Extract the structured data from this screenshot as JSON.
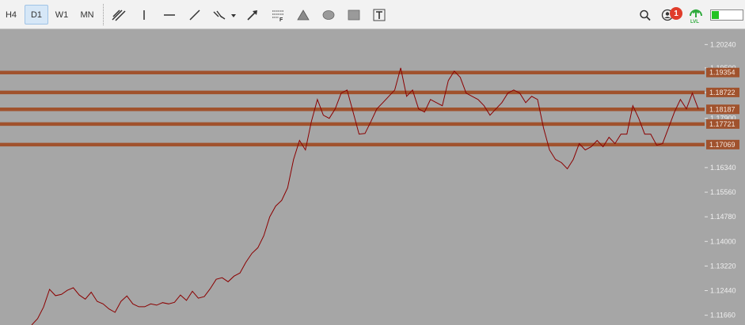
{
  "toolbar": {
    "timeframes": [
      {
        "label": "H4",
        "active": false
      },
      {
        "label": "D1",
        "active": true
      },
      {
        "label": "W1",
        "active": false
      },
      {
        "label": "MN",
        "active": false
      }
    ],
    "notification_count": "1",
    "lvl_label": "LVL",
    "icons": [
      "channel-icon",
      "vertical-line-icon",
      "horizontal-line-icon",
      "trend-line-icon",
      "shapes-dropdown-icon",
      "arrow-icon",
      "fibonacci-icon",
      "triangle-icon",
      "ellipse-icon",
      "rectangle-icon",
      "text-icon",
      "search-icon",
      "account-icon",
      "level-icon",
      "battery-icon"
    ]
  },
  "colors": {
    "chart_bg": "#a6a6a6",
    "price_line": "#8b0000",
    "level_line": "#a0522d",
    "axis_text": "#f0f0f0"
  },
  "chart_data": {
    "type": "line",
    "ylim": [
      1.1135,
      1.207
    ],
    "y_ticks": [
      "1.20240",
      "1.19500",
      "1.18720",
      "1.17900",
      "1.16340",
      "1.15560",
      "1.14780",
      "1.14000",
      "1.13220",
      "1.12440",
      "1.11660"
    ],
    "levels": [
      {
        "label": "1.19354",
        "value": 1.19354
      },
      {
        "label": "1.18722",
        "value": 1.18722
      },
      {
        "label": "1.18187",
        "value": 1.18187
      },
      {
        "label": "1.17721",
        "value": 1.17721
      },
      {
        "label": "1.17069",
        "value": 1.17069
      }
    ],
    "series": [
      {
        "values": [
          1.1135,
          1.1155,
          1.1192,
          1.1248,
          1.1228,
          1.1232,
          1.1245,
          1.1253,
          1.123,
          1.1217,
          1.1239,
          1.121,
          1.1202,
          1.1186,
          1.1175,
          1.121,
          1.1227,
          1.1202,
          1.1193,
          1.1193,
          1.1202,
          1.1198,
          1.1206,
          1.1202,
          1.1207,
          1.123,
          1.1213,
          1.1242,
          1.122,
          1.1225,
          1.125,
          1.128,
          1.1285,
          1.1272,
          1.129,
          1.13,
          1.1334,
          1.1362,
          1.138,
          1.1418,
          1.1478,
          1.1512,
          1.153,
          1.157,
          1.166,
          1.172,
          1.169,
          1.178,
          1.185,
          1.18,
          1.179,
          1.182,
          1.187,
          1.188,
          1.181,
          1.174,
          1.1742,
          1.178,
          1.182,
          1.184,
          1.186,
          1.188,
          1.195,
          1.186,
          1.188,
          1.182,
          1.181,
          1.185,
          1.184,
          1.183,
          1.191,
          1.194,
          1.192,
          1.187,
          1.186,
          1.185,
          1.183,
          1.18,
          1.182,
          1.184,
          1.187,
          1.188,
          1.187,
          1.184,
          1.186,
          1.185,
          1.176,
          1.169,
          1.166,
          1.165,
          1.163,
          1.166,
          1.171,
          1.169,
          1.17,
          1.172,
          1.17,
          1.173,
          1.171,
          1.174,
          1.174,
          1.183,
          1.179,
          1.174,
          1.174,
          1.1705,
          1.171,
          1.176,
          1.181,
          1.185,
          1.182,
          1.187,
          1.182
        ]
      }
    ]
  }
}
